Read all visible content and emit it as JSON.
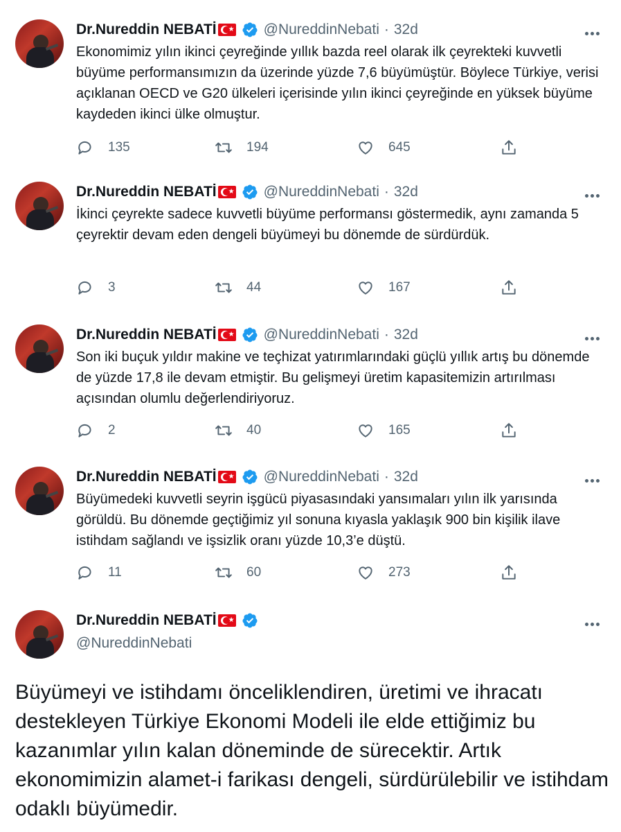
{
  "tweets": [
    {
      "name": "Dr.Nureddin NEBATİ",
      "handle": "@NureddinNebati",
      "time": "32d",
      "text": "Ekonomimiz yılın ikinci çeyreğinde yıllık bazda reel olarak ilk çeyrekteki kuvvetli büyüme performansımızın da üzerinde yüzde 7,6 büyümüştür. Böylece Türkiye, verisi açıklanan OECD ve G20 ülkeleri içerisinde yılın ikinci çeyreğinde en yüksek büyüme kaydeden ikinci ülke olmuştur.",
      "replies": "135",
      "retweets": "194",
      "likes": "645"
    },
    {
      "name": "Dr.Nureddin NEBATİ",
      "handle": "@NureddinNebati",
      "time": "32d",
      "text": "İkinci çeyrekte sadece kuvvetli büyüme performansı göstermedik, aynı zamanda 5 çeyrektir devam eden dengeli büyümeyi bu dönemde de sürdürdük.",
      "replies": "3",
      "retweets": "44",
      "likes": "167"
    },
    {
      "name": "Dr.Nureddin NEBATİ",
      "handle": "@NureddinNebati",
      "time": "32d",
      "text": "Son iki buçuk yıldır makine ve teçhizat yatırımlarındaki güçlü yıllık artış bu dönemde de yüzde 17,8 ile devam etmiştir. Bu gelişmeyi üretim kapasitemizin artırılması açısından olumlu değerlendiriyoruz.",
      "replies": "2",
      "retweets": "40",
      "likes": "165"
    },
    {
      "name": "Dr.Nureddin NEBATİ",
      "handle": "@NureddinNebati",
      "time": "32d",
      "text": "Büyümedeki kuvvetli seyrin işgücü piyasasındaki yansımaları yılın ilk yarısında görüldü. Bu dönemde geçtiğimiz yıl sonuna kıyasla yaklaşık 900 bin kişilik ilave istihdam sağlandı ve işsizlik oranı yüzde 10,3’e düştü.",
      "replies": "11",
      "retweets": "60",
      "likes": "273"
    }
  ],
  "last_tweet": {
    "name": "Dr.Nureddin NEBATİ",
    "handle": "@NureddinNebati",
    "text": "Büyümeyi ve istihdamı önceliklendiren, üretimi ve ihracatı destekleyen Türkiye Ekonomi Modeli ile elde ettiğimiz bu kazanımlar yılın kalan döneminde de sürecektir. Artık ekonomimizin alamet-i farikası dengeli, sürdürülebilir ve istihdam odaklı büyümedir."
  },
  "colors": {
    "text": "#0f1419",
    "secondary": "#536471",
    "verified": "#1d9bf0",
    "flag": "#e30a17"
  }
}
